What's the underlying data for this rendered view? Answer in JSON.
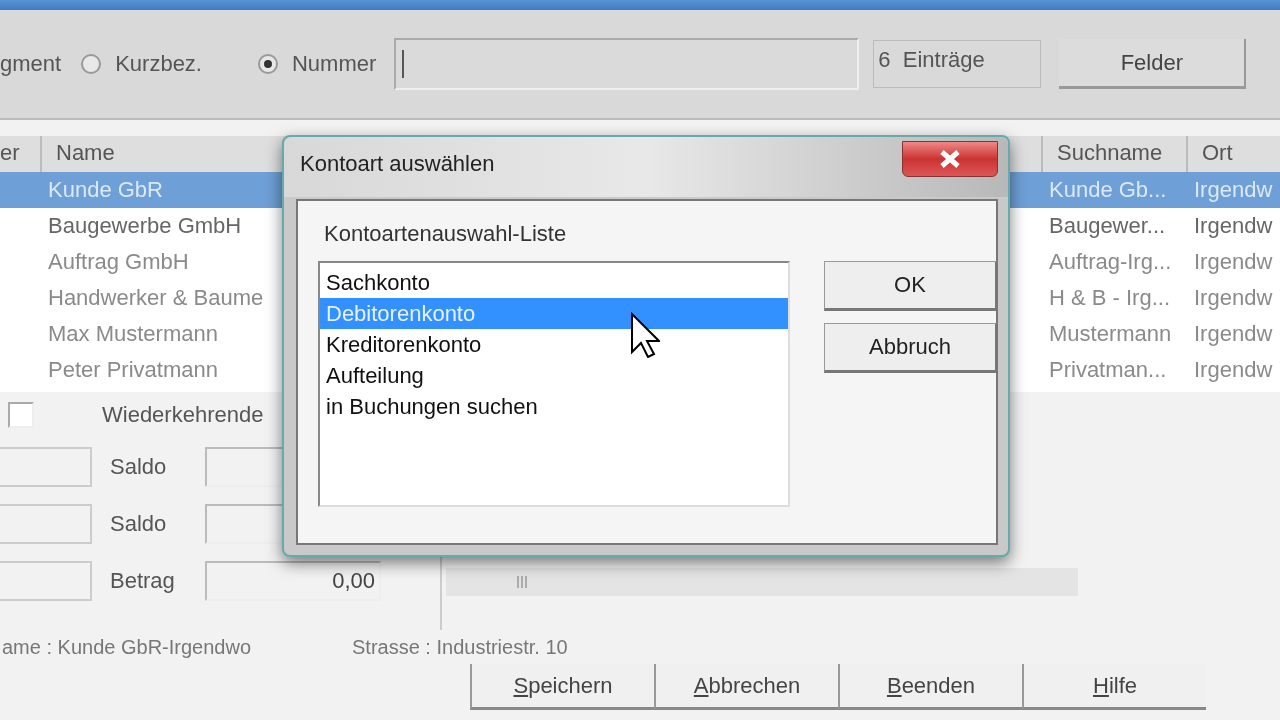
{
  "search_bar": {
    "cut_label": "gment",
    "options": [
      {
        "label": "Kurzbez.",
        "selected": false
      },
      {
        "label": "Nummer",
        "selected": true
      }
    ],
    "count": "6  Einträge",
    "fields_button": "Felder"
  },
  "table": {
    "columns": {
      "column_1": "er",
      "name": "Name",
      "suchname": "Suchname",
      "ort": "Ort"
    },
    "rows": [
      {
        "name": "Kunde GbR",
        "suchname": "Kunde Gb...",
        "ort": "Irgendw",
        "selected": true
      },
      {
        "name": "Baugewerbe GmbH",
        "suchname": "Baugewer...",
        "ort": "Irgendw",
        "selected": false
      },
      {
        "name": "Auftrag GmbH",
        "suchname": "Auftrag-Irg...",
        "ort": "Irgendw",
        "selected": false
      },
      {
        "name": "Handwerker & Baume",
        "suchname": "H & B - Irg...",
        "ort": "Irgendw",
        "selected": false
      },
      {
        "name": "Max Mustermann",
        "suchname": "Mustermann",
        "ort": "Irgendw",
        "selected": false
      },
      {
        "name": "Peter Privatmann",
        "suchname": "Privatman...",
        "ort": "Irgendw",
        "selected": false
      }
    ]
  },
  "form": {
    "recurring": {
      "label": "Wiederkehrende",
      "checked": false
    },
    "rows": [
      {
        "label": "Saldo"
      },
      {
        "label": "Saldo"
      },
      {
        "label": "Betrag",
        "value": "0,00"
      }
    ]
  },
  "status": {
    "name": "ame : Kunde GbR-Irgendwo",
    "street": "Strasse : Industriestr. 10"
  },
  "buttons": [
    "Speichern",
    "Abbrechen",
    "Beenden",
    "Hilfe"
  ],
  "dialog": {
    "title": "Kontoart auswählen",
    "list_label": "Kontoartenauswahl-Liste",
    "items": [
      {
        "label": "Sachkonto",
        "selected": false
      },
      {
        "label": "Debitorenkonto",
        "selected": true
      },
      {
        "label": "Kreditorenkonto",
        "selected": false
      },
      {
        "label": "Aufteilung",
        "selected": false
      },
      {
        "label": "in Buchungen suchen",
        "selected": false
      }
    ],
    "buttons": [
      "OK",
      "Abbruch"
    ]
  }
}
